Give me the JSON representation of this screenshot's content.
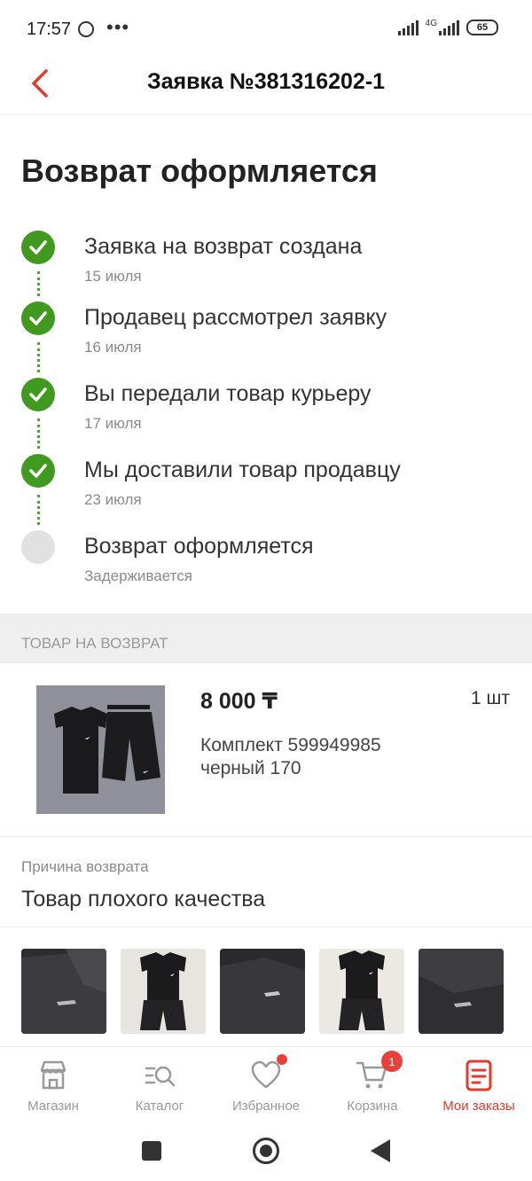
{
  "status_bar": {
    "time": "17:57",
    "more": "•••",
    "network": "4G",
    "battery": "65"
  },
  "header": {
    "title": "Заявка №381316202-1"
  },
  "main": {
    "section_title": "Возврат оформляется",
    "steps": [
      {
        "title": "Заявка на возврат создана",
        "date": "15 июля",
        "done": true
      },
      {
        "title": "Продавец рассмотрел заявку",
        "date": "16 июля",
        "done": true
      },
      {
        "title": "Вы передали товар курьеру",
        "date": "17 июля",
        "done": true
      },
      {
        "title": "Мы доставили товар продавцу",
        "date": "23 июля",
        "done": true
      },
      {
        "title": "Возврат оформляется",
        "date": "Задерживается",
        "done": false
      }
    ],
    "product_section_label": "ТОВАР НА ВОЗВРАТ",
    "product": {
      "price": "8 000 ₸",
      "quantity": "1 шт",
      "name_line1": "Комплект 599949985",
      "name_line2": "черный 170"
    },
    "reason": {
      "label": "Причина возврата",
      "value": "Товар плохого качества"
    }
  },
  "tabbar": {
    "items": [
      {
        "label": "Магазин",
        "icon": "store-icon"
      },
      {
        "label": "Каталог",
        "icon": "catalog-search-icon"
      },
      {
        "label": "Избранное",
        "icon": "heart-icon"
      },
      {
        "label": "Корзина",
        "icon": "cart-icon",
        "badge": "1"
      },
      {
        "label": "Мои заказы",
        "icon": "orders-icon",
        "active": true
      }
    ]
  },
  "colors": {
    "accent": "#e23b2e",
    "success": "#3f9a1f",
    "muted": "#8a8a8a"
  }
}
